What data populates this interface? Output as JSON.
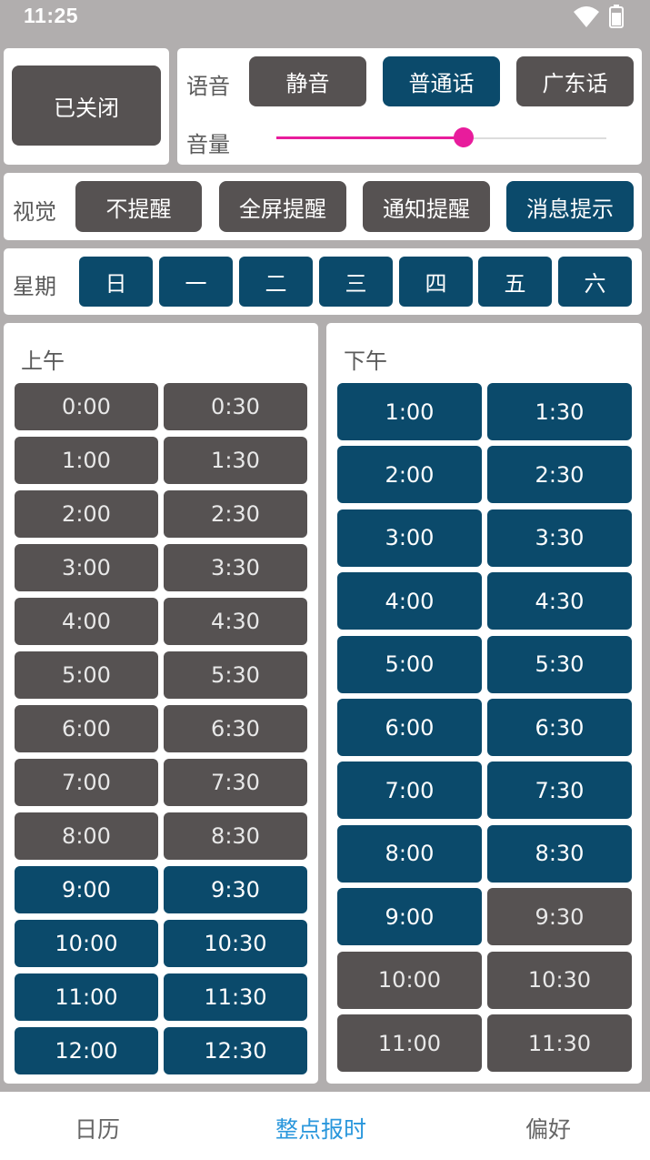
{
  "status": {
    "time": "11:25",
    "wifi_icon": "wifi-icon",
    "battery_icon": "battery-icon"
  },
  "power": {
    "label": "已关闭",
    "active": false
  },
  "voice": {
    "label": "语音",
    "options": [
      {
        "label": "静音",
        "active": false
      },
      {
        "label": "普通话",
        "active": true
      },
      {
        "label": "广东话",
        "active": false
      }
    ]
  },
  "volume": {
    "label": "音量",
    "value": 0.57
  },
  "visual": {
    "label": "视觉",
    "options": [
      {
        "label": "不提醒",
        "active": false
      },
      {
        "label": "全屏提醒",
        "active": false
      },
      {
        "label": "通知提醒",
        "active": false
      },
      {
        "label": "消息提示",
        "active": true
      }
    ]
  },
  "week": {
    "label": "星期",
    "days": [
      {
        "label": "日",
        "active": true
      },
      {
        "label": "一",
        "active": true
      },
      {
        "label": "二",
        "active": true
      },
      {
        "label": "三",
        "active": true
      },
      {
        "label": "四",
        "active": true
      },
      {
        "label": "五",
        "active": true
      },
      {
        "label": "六",
        "active": true
      }
    ]
  },
  "am": {
    "title": "上午",
    "slots": [
      {
        "label": "0:00",
        "active": false
      },
      {
        "label": "0:30",
        "active": false
      },
      {
        "label": "1:00",
        "active": false
      },
      {
        "label": "1:30",
        "active": false
      },
      {
        "label": "2:00",
        "active": false
      },
      {
        "label": "2:30",
        "active": false
      },
      {
        "label": "3:00",
        "active": false
      },
      {
        "label": "3:30",
        "active": false
      },
      {
        "label": "4:00",
        "active": false
      },
      {
        "label": "4:30",
        "active": false
      },
      {
        "label": "5:00",
        "active": false
      },
      {
        "label": "5:30",
        "active": false
      },
      {
        "label": "6:00",
        "active": false
      },
      {
        "label": "6:30",
        "active": false
      },
      {
        "label": "7:00",
        "active": false
      },
      {
        "label": "7:30",
        "active": false
      },
      {
        "label": "8:00",
        "active": false
      },
      {
        "label": "8:30",
        "active": false
      },
      {
        "label": "9:00",
        "active": true
      },
      {
        "label": "9:30",
        "active": true
      },
      {
        "label": "10:00",
        "active": true
      },
      {
        "label": "10:30",
        "active": true
      },
      {
        "label": "11:00",
        "active": true
      },
      {
        "label": "11:30",
        "active": true
      },
      {
        "label": "12:00",
        "active": true
      },
      {
        "label": "12:30",
        "active": true
      }
    ]
  },
  "pm": {
    "title": "下午",
    "slots": [
      {
        "label": "1:00",
        "active": true
      },
      {
        "label": "1:30",
        "active": true
      },
      {
        "label": "2:00",
        "active": true
      },
      {
        "label": "2:30",
        "active": true
      },
      {
        "label": "3:00",
        "active": true
      },
      {
        "label": "3:30",
        "active": true
      },
      {
        "label": "4:00",
        "active": true
      },
      {
        "label": "4:30",
        "active": true
      },
      {
        "label": "5:00",
        "active": true
      },
      {
        "label": "5:30",
        "active": true
      },
      {
        "label": "6:00",
        "active": true
      },
      {
        "label": "6:30",
        "active": true
      },
      {
        "label": "7:00",
        "active": true
      },
      {
        "label": "7:30",
        "active": true
      },
      {
        "label": "8:00",
        "active": true
      },
      {
        "label": "8:30",
        "active": true
      },
      {
        "label": "9:00",
        "active": true
      },
      {
        "label": "9:30",
        "active": false
      },
      {
        "label": "10:00",
        "active": false
      },
      {
        "label": "10:30",
        "active": false
      },
      {
        "label": "11:00",
        "active": false
      },
      {
        "label": "11:30",
        "active": false
      }
    ]
  },
  "nav": {
    "items": [
      {
        "label": "日历",
        "active": false
      },
      {
        "label": "整点报时",
        "active": true
      },
      {
        "label": "偏好",
        "active": false
      }
    ]
  },
  "colors": {
    "active": "#0b4a6b",
    "inactive": "#565252",
    "accent": "#e81c9c",
    "nav_active": "#2a97dc",
    "background": "#b1aeae"
  }
}
